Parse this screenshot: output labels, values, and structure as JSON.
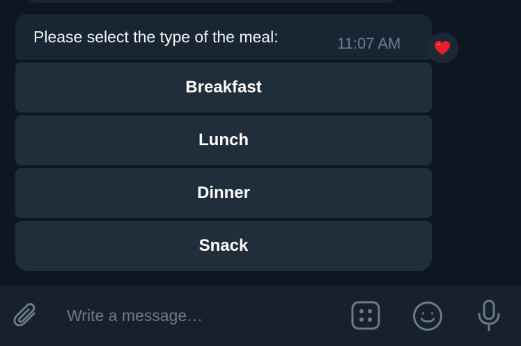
{
  "message": {
    "text": "Please select the type of the meal:",
    "time": "11:07 AM",
    "reaction": "heart-emoji"
  },
  "keyboard": {
    "buttons": [
      "Breakfast",
      "Lunch",
      "Dinner",
      "Snack"
    ]
  },
  "composer": {
    "placeholder": "Write a message…",
    "icons": [
      "paperclip-icon",
      "bot-menu-dice-icon",
      "emoji-icon",
      "microphone-icon"
    ]
  },
  "colors": {
    "background": "#0e1621",
    "bubble": "#182533",
    "button": "#202d3b",
    "composer": "#17212b",
    "icon": "#6b7a89",
    "reaction": "#e81e2a"
  }
}
